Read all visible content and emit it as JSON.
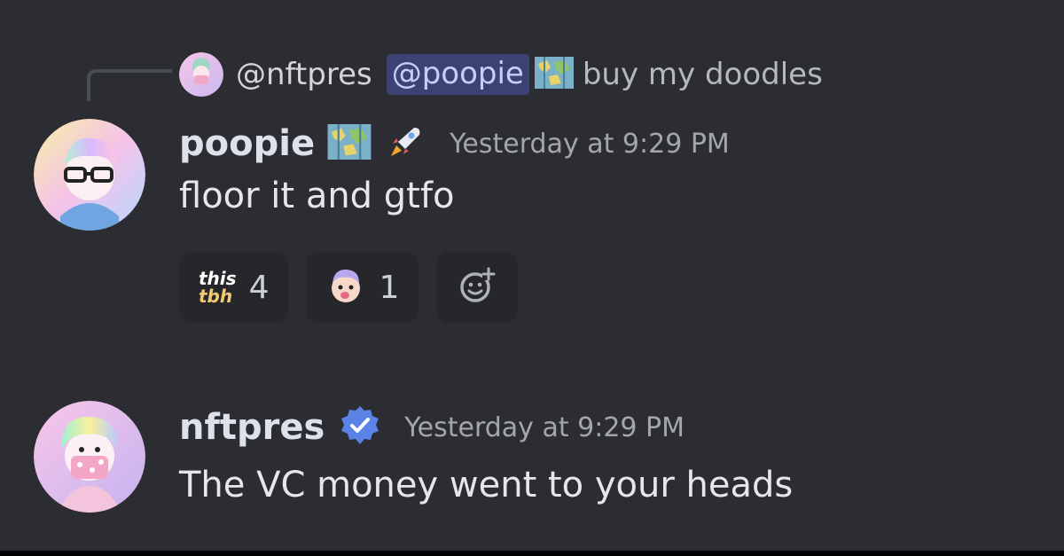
{
  "reply": {
    "author": "@nftpres",
    "mention": "@poopie",
    "text": "buy my doodles"
  },
  "messages": [
    {
      "username": "poopie",
      "timestamp": "Yesterday at 9:29 PM",
      "text": "floor it and gtfo",
      "reactions": [
        {
          "emoji_top": "this",
          "emoji_bottom": "tbh",
          "count": "4"
        },
        {
          "emoji": "doodle-face-emoji",
          "count": "1"
        }
      ]
    },
    {
      "username": "nftpres",
      "timestamp": "Yesterday at 9:29 PM",
      "text": "The VC money went to your heads"
    }
  ],
  "colors": {
    "background": "#2c2d32",
    "mention_bg": "#3c4273",
    "mention_text": "#c9cdfb",
    "verified_badge": "#5b82e6"
  }
}
